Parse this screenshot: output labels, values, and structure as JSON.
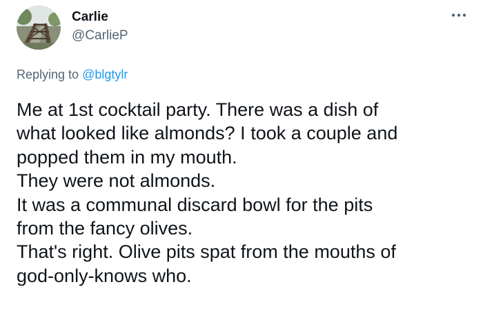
{
  "tweet": {
    "author": {
      "display_name": "Carlie",
      "handle": "@CarlieP",
      "avatar_icon": "bridge-photo-avatar"
    },
    "menu_icon": "more-options-icon",
    "reply": {
      "prefix": "Replying to ",
      "mention": "@blgtylr"
    },
    "body_lines": [
      "Me at 1st cocktail party. There was a dish of",
      "what looked like almonds? I took a couple and",
      "popped them in my mouth.",
      "They were not almonds.",
      "It was a communal discard bowl for the pits",
      "from the fancy olives.",
      "That's right. Olive pits spat from the mouths of",
      "god-only-knows who."
    ],
    "colors": {
      "text_primary": "#0f1419",
      "text_secondary": "#536471",
      "link": "#1d9bf0"
    }
  }
}
